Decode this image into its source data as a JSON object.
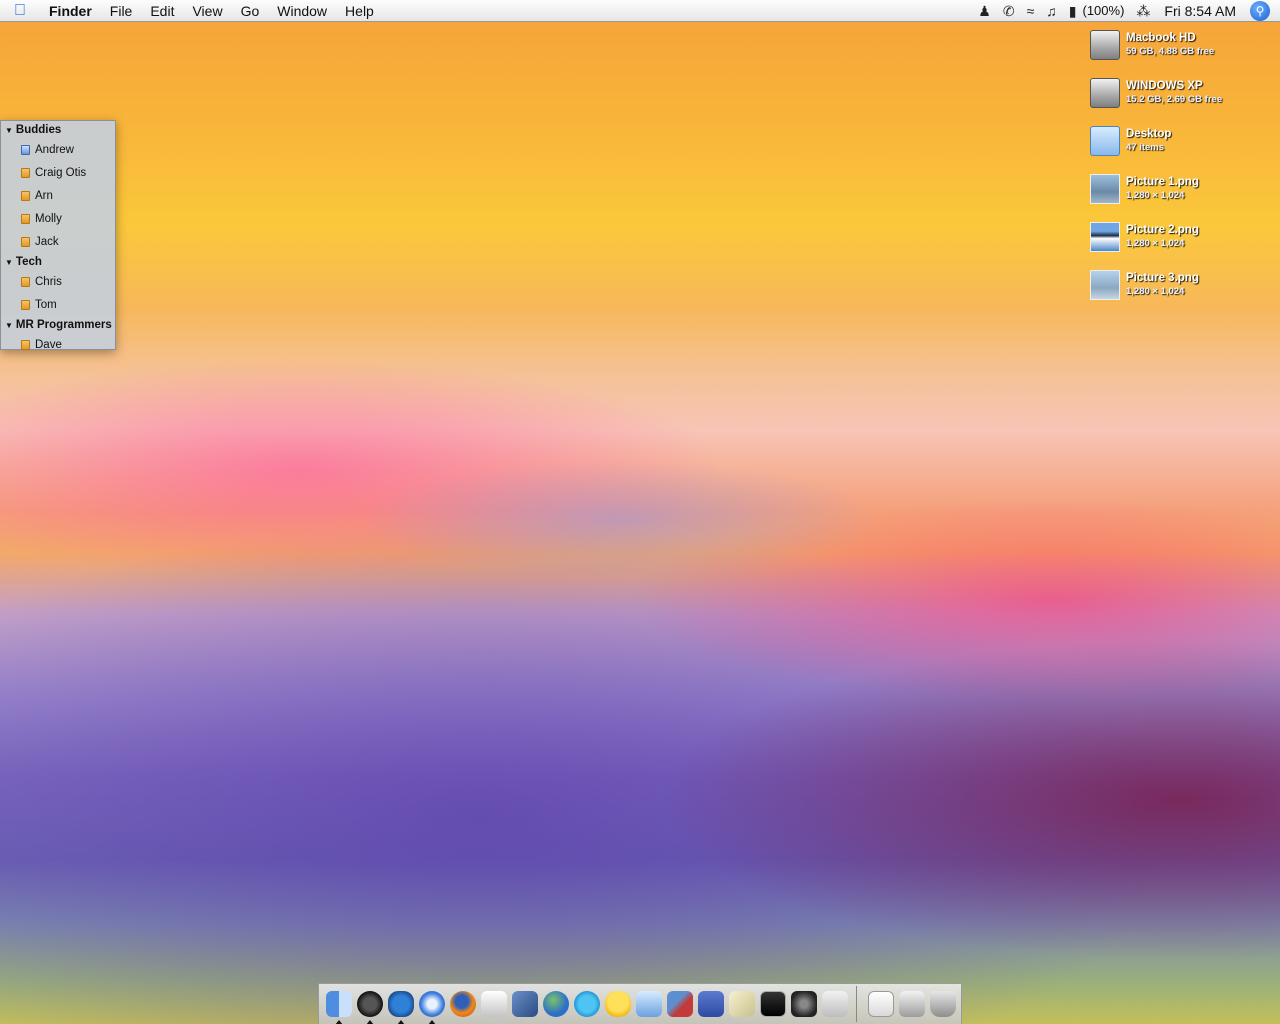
{
  "menubar": {
    "apple_icon": "apple-icon",
    "app_name": "Finder",
    "menus": [
      "File",
      "Edit",
      "View",
      "Go",
      "Window",
      "Help"
    ],
    "battery_percent": "(100%)",
    "clock": "Fri 8:54 AM"
  },
  "buddy_list": {
    "groups": [
      {
        "name": "Buddies",
        "buddies": [
          "Andrew",
          "Craig Otis",
          "Arn",
          "Molly",
          "Jack"
        ]
      },
      {
        "name": "Tech",
        "buddies": [
          "Chris",
          "Tom"
        ]
      },
      {
        "name": "MR Programmers",
        "buddies": [
          "Dave"
        ]
      }
    ]
  },
  "desktop": {
    "icons": [
      {
        "name": "Macbook HD",
        "sub": "59 GB, 4.88 GB free",
        "icon": "hard-drive-icon"
      },
      {
        "name": "WINDOWS XP",
        "sub": "15.2 GB, 2.69 GB free",
        "icon": "hard-drive-icon"
      },
      {
        "name": "Desktop",
        "sub": "47 items",
        "icon": "folder-icon"
      },
      {
        "name": "Picture 1.png",
        "sub": "1,280 × 1,024",
        "icon": "image-thumbnail"
      },
      {
        "name": "Picture 2.png",
        "sub": "1,280 × 1,024",
        "icon": "image-thumbnail"
      },
      {
        "name": "Picture 3.png",
        "sub": "1,280 × 1,024",
        "icon": "image-thumbnail"
      }
    ]
  },
  "dock": {
    "apps": [
      "finder-icon",
      "dashboard-icon",
      "adium-icon",
      "safari-icon",
      "firefox-icon",
      "tool-icon",
      "preview-icon",
      "globe-icon",
      "skype-icon",
      "cyberduck-icon",
      "itunes-icon",
      "virtual-machine-icon",
      "xcode-icon",
      "pen-icon",
      "terminal-icon",
      "photo-icon",
      "apple-app-icon"
    ],
    "documents": [
      "document-icon",
      "printer-icon",
      "trash-icon"
    ]
  }
}
